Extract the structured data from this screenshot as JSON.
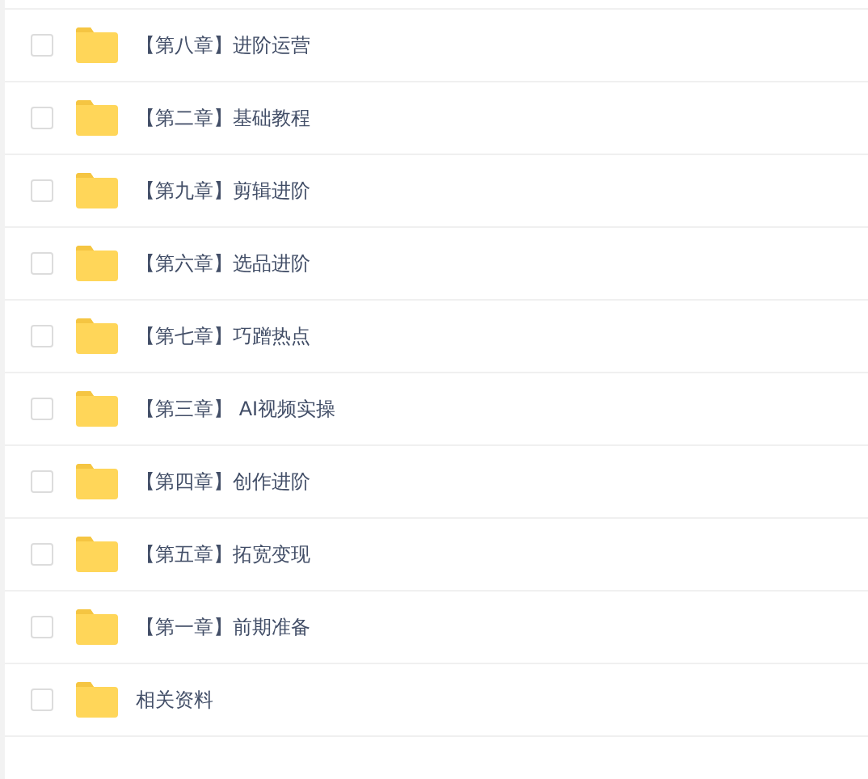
{
  "files": [
    {
      "name": "【第八章】进阶运营",
      "checked": false
    },
    {
      "name": "【第二章】基础教程",
      "checked": false
    },
    {
      "name": "【第九章】剪辑进阶",
      "checked": false
    },
    {
      "name": "【第六章】选品进阶",
      "checked": false
    },
    {
      "name": "【第七章】巧蹭热点",
      "checked": false
    },
    {
      "name": "【第三章】 AI视频实操",
      "checked": false
    },
    {
      "name": "【第四章】创作进阶",
      "checked": false
    },
    {
      "name": "【第五章】拓宽变现",
      "checked": false
    },
    {
      "name": "【第一章】前期准备",
      "checked": false
    },
    {
      "name": "相关资料",
      "checked": false
    }
  ]
}
